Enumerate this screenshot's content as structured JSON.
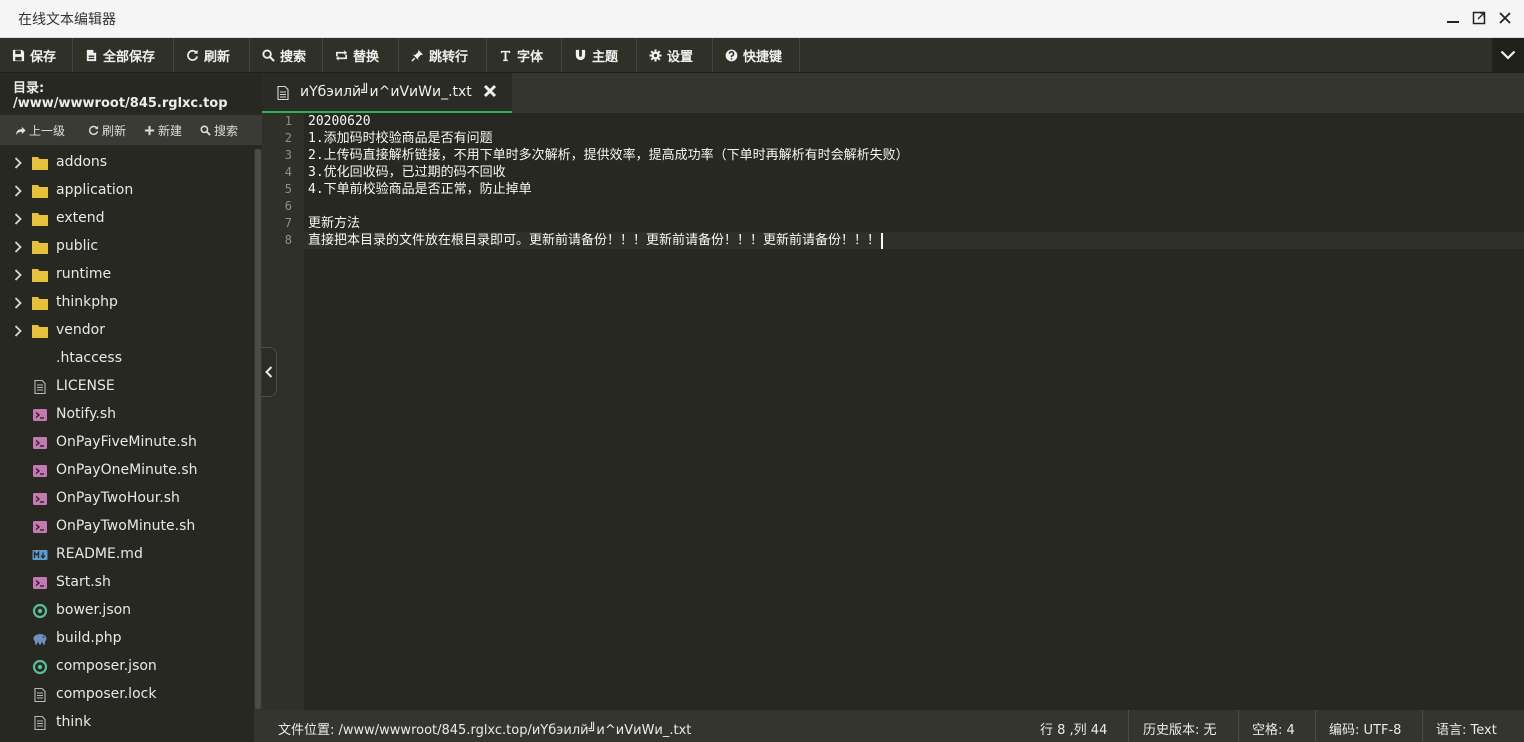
{
  "window": {
    "title": "在线文本编辑器"
  },
  "toolbar": {
    "save": "保存",
    "save_all": "全部保存",
    "refresh": "刷新",
    "search": "搜索",
    "replace": "替换",
    "goto_line": "跳转行",
    "font": "字体",
    "theme": "主题",
    "settings": "设置",
    "shortcuts": "快捷键"
  },
  "sidebar": {
    "directory": "目录: /www/wwwroot/845.rglxc.top",
    "actions": {
      "up": "上一级",
      "refresh": "刷新",
      "new": "新建",
      "search": "搜索"
    },
    "items": [
      {
        "name": "addons",
        "type": "folder"
      },
      {
        "name": "application",
        "type": "folder"
      },
      {
        "name": "extend",
        "type": "folder"
      },
      {
        "name": "public",
        "type": "folder"
      },
      {
        "name": "runtime",
        "type": "folder"
      },
      {
        "name": "thinkphp",
        "type": "folder"
      },
      {
        "name": "vendor",
        "type": "folder"
      },
      {
        "name": ".htaccess",
        "type": "blank"
      },
      {
        "name": "LICENSE",
        "type": "text"
      },
      {
        "name": "Notify.sh",
        "type": "shell"
      },
      {
        "name": "OnPayFiveMinute.sh",
        "type": "shell"
      },
      {
        "name": "OnPayOneMinute.sh",
        "type": "shell"
      },
      {
        "name": "OnPayTwoHour.sh",
        "type": "shell"
      },
      {
        "name": "OnPayTwoMinute.sh",
        "type": "shell"
      },
      {
        "name": "README.md",
        "type": "markdown"
      },
      {
        "name": "Start.sh",
        "type": "shell"
      },
      {
        "name": "bower.json",
        "type": "json"
      },
      {
        "name": "build.php",
        "type": "php"
      },
      {
        "name": "composer.json",
        "type": "json"
      },
      {
        "name": "composer.lock",
        "type": "text"
      },
      {
        "name": "think",
        "type": "text"
      }
    ]
  },
  "tab": {
    "name": "иYбэилй╝и^иVиWи_.txt"
  },
  "editor": {
    "lines": [
      "20200620",
      "1.添加码时校验商品是否有问题",
      "2.上传码直接解析链接，不用下单时多次解析，提供效率，提高成功率（下单时再解析有时会解析失败）",
      "3.优化回收码，已过期的码不回收",
      "4.下单前校验商品是否正常，防止掉单",
      "",
      "更新方法",
      "直接把本目录的文件放在根目录即可。更新前请备份！！！更新前请备份！！！更新前请备份！！！"
    ],
    "active_line": 8
  },
  "status": {
    "file_path": "文件位置: /www/wwwroot/845.rglxc.top/иYбэилй╝и^иVиWи_.txt",
    "cursor": "行 8 ,列 44",
    "history": "历史版本: 无",
    "spaces": "空格: 4",
    "encoding": "编码: UTF-8",
    "language": "语言: Text"
  },
  "colors": {
    "folder": "#e6c13d",
    "shell": "#c678b4",
    "json": "#5bbf9f",
    "active_tab_border": "#2bb35a",
    "editor_bg": "#272822"
  }
}
